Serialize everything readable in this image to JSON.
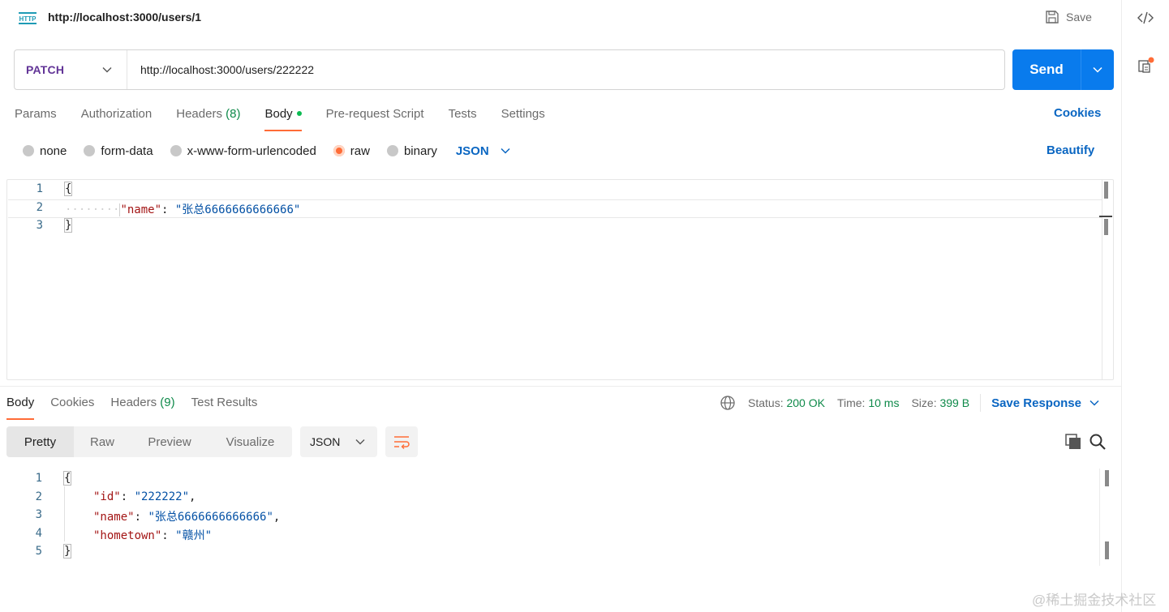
{
  "request": {
    "title": "http://localhost:3000/users/1",
    "type_badge": "HTTP",
    "save_label": "Save",
    "method": "PATCH",
    "url": "http://localhost:3000/users/222222",
    "send_label": "Send"
  },
  "request_tabs": {
    "params": "Params",
    "authorization": "Authorization",
    "headers": "Headers",
    "headers_count": "(8)",
    "body": "Body",
    "pre_request": "Pre-request Script",
    "tests": "Tests",
    "settings": "Settings",
    "active": "Body"
  },
  "cookies_label": "Cookies",
  "body_types": {
    "none": "none",
    "form_data": "form-data",
    "urlencoded": "x-www-form-urlencoded",
    "raw": "raw",
    "binary": "binary",
    "selected": "raw",
    "format": "JSON"
  },
  "beautify_label": "Beautify",
  "request_body": {
    "line_numbers": [
      "1",
      "2",
      "3"
    ],
    "open": "{",
    "key": "\"name\"",
    "sep": ": ",
    "value": "\"张总6666666666666\"",
    "close": "}"
  },
  "response_tabs": {
    "body": "Body",
    "cookies": "Cookies",
    "headers": "Headers",
    "headers_count": "(9)",
    "test_results": "Test Results"
  },
  "response_status": {
    "status_label": "Status:",
    "status_value": "200 OK",
    "time_label": "Time:",
    "time_value": "10 ms",
    "size_label": "Size:",
    "size_value": "399 B",
    "save_response": "Save Response"
  },
  "response_view": {
    "pretty": "Pretty",
    "raw": "Raw",
    "preview": "Preview",
    "visualize": "Visualize",
    "format": "JSON"
  },
  "response_body": {
    "line_numbers": [
      "1",
      "2",
      "3",
      "4",
      "5"
    ],
    "open": "{",
    "id_key": "\"id\"",
    "id_value": "\"222222\"",
    "name_key": "\"name\"",
    "name_value": "\"张总6666666666666\"",
    "hometown_key": "\"hometown\"",
    "hometown_value": "\"赣州\"",
    "close": "}"
  },
  "watermark": "@稀土掘金技术社区",
  "colors": {
    "accent": "#ff6c37",
    "send": "#097bed",
    "link": "#0a66c2",
    "method": "#623497",
    "success": "#0f8a4a"
  }
}
